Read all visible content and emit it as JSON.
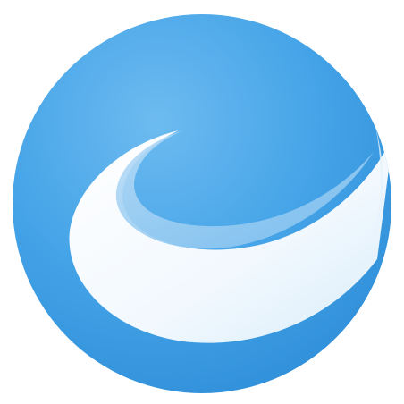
{
  "logo": {
    "icon": "wave-swirl-logo-icon",
    "colors": {
      "background": "#ffffff",
      "circle_light": "#67b8ef",
      "circle_main": "#3c9fe6",
      "circle_dark": "#2f8fd8",
      "swirl_highlight": "#f3f9fe",
      "swirl_shadow": "#cfe6f8",
      "inner_light": "#a9d3f4"
    }
  }
}
